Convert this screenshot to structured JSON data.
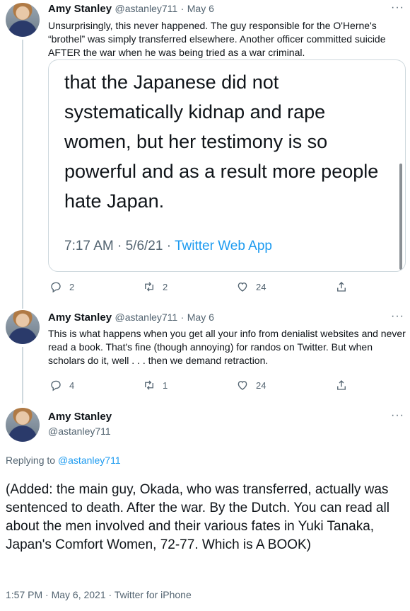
{
  "tweet1": {
    "name": "Amy Stanley",
    "handle": "@astanley711",
    "dot": "·",
    "date": "May 6",
    "more": "···",
    "text": "Unsurprisingly, this never happened. The guy responsible for the O'Herne's “brothel” was simply transferred elsewhere. Another officer committed suicide AFTER the war when he was being tried as a war criminal.",
    "card": {
      "lines": [
        "that the Japanese did not",
        "systematically kidnap and rape",
        "women, but her testimony is so",
        "powerful and as a result more people",
        "hate Japan."
      ],
      "time": "7:17 AM · 5/6/21 · ",
      "source": "Twitter Web App"
    },
    "actions": {
      "replies": "2",
      "retweets": "2",
      "likes": "24"
    }
  },
  "tweet2": {
    "name": "Amy Stanley",
    "handle": "@astanley711",
    "dot": "·",
    "date": "May 6",
    "more": "···",
    "text": "This is what happens when you get all your info from denialist websites and never read a book. That's fine (though annoying) for randos on Twitter. But when scholars do it, well . . . then we demand retraction.",
    "actions": {
      "replies": "4",
      "retweets": "1",
      "likes": "24"
    }
  },
  "tweet3": {
    "name": "Amy Stanley",
    "handle": "@astanley711",
    "more": "···",
    "replying_prefix": "Replying to ",
    "replying_handle": "@astanley711",
    "text": "(Added: the main guy, Okada, who was transferred, actually was sentenced to death. After the war. By the Dutch. You can read all about the men involved and their various fates in Yuki Tanaka, Japan's Comfort Women, 72-77. Which is A BOOK)",
    "timestamp": "1:57 PM · May 6, 2021 · Twitter for iPhone"
  },
  "colors": {
    "accent": "#1d9bf0",
    "secondary": "#536471",
    "border": "#cfd9de"
  },
  "icons": [
    "reply-icon",
    "retweet-icon",
    "like-icon",
    "share-icon",
    "more-icon"
  ]
}
